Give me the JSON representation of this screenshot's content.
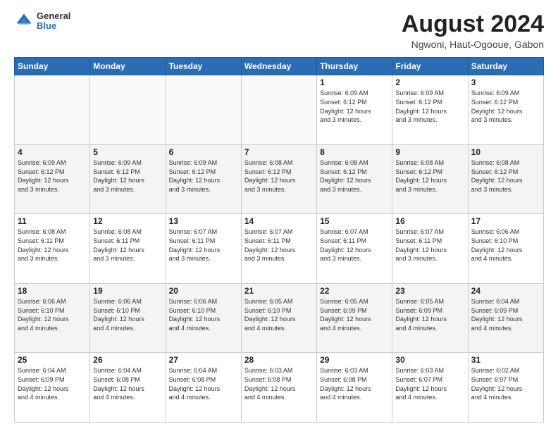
{
  "header": {
    "logo": {
      "general": "General",
      "blue": "Blue"
    },
    "title": "August 2024",
    "subtitle": "Ngwoni, Haut-Ogooue, Gabon"
  },
  "calendar": {
    "days_of_week": [
      "Sunday",
      "Monday",
      "Tuesday",
      "Wednesday",
      "Thursday",
      "Friday",
      "Saturday"
    ],
    "weeks": [
      {
        "row_bg": "white",
        "days": [
          {
            "num": "",
            "info": ""
          },
          {
            "num": "",
            "info": ""
          },
          {
            "num": "",
            "info": ""
          },
          {
            "num": "",
            "info": ""
          },
          {
            "num": "1",
            "info": "Sunrise: 6:09 AM\nSunset: 6:12 PM\nDaylight: 12 hours\nand 3 minutes."
          },
          {
            "num": "2",
            "info": "Sunrise: 6:09 AM\nSunset: 6:12 PM\nDaylight: 12 hours\nand 3 minutes."
          },
          {
            "num": "3",
            "info": "Sunrise: 6:09 AM\nSunset: 6:12 PM\nDaylight: 12 hours\nand 3 minutes."
          }
        ]
      },
      {
        "row_bg": "gray",
        "days": [
          {
            "num": "4",
            "info": "Sunrise: 6:09 AM\nSunset: 6:12 PM\nDaylight: 12 hours\nand 3 minutes."
          },
          {
            "num": "5",
            "info": "Sunrise: 6:09 AM\nSunset: 6:12 PM\nDaylight: 12 hours\nand 3 minutes."
          },
          {
            "num": "6",
            "info": "Sunrise: 6:09 AM\nSunset: 6:12 PM\nDaylight: 12 hours\nand 3 minutes."
          },
          {
            "num": "7",
            "info": "Sunrise: 6:08 AM\nSunset: 6:12 PM\nDaylight: 12 hours\nand 3 minutes."
          },
          {
            "num": "8",
            "info": "Sunrise: 6:08 AM\nSunset: 6:12 PM\nDaylight: 12 hours\nand 3 minutes."
          },
          {
            "num": "9",
            "info": "Sunrise: 6:08 AM\nSunset: 6:12 PM\nDaylight: 12 hours\nand 3 minutes."
          },
          {
            "num": "10",
            "info": "Sunrise: 6:08 AM\nSunset: 6:12 PM\nDaylight: 12 hours\nand 3 minutes."
          }
        ]
      },
      {
        "row_bg": "white",
        "days": [
          {
            "num": "11",
            "info": "Sunrise: 6:08 AM\nSunset: 6:11 PM\nDaylight: 12 hours\nand 3 minutes."
          },
          {
            "num": "12",
            "info": "Sunrise: 6:08 AM\nSunset: 6:11 PM\nDaylight: 12 hours\nand 3 minutes."
          },
          {
            "num": "13",
            "info": "Sunrise: 6:07 AM\nSunset: 6:11 PM\nDaylight: 12 hours\nand 3 minutes."
          },
          {
            "num": "14",
            "info": "Sunrise: 6:07 AM\nSunset: 6:11 PM\nDaylight: 12 hours\nand 3 minutes."
          },
          {
            "num": "15",
            "info": "Sunrise: 6:07 AM\nSunset: 6:11 PM\nDaylight: 12 hours\nand 3 minutes."
          },
          {
            "num": "16",
            "info": "Sunrise: 6:07 AM\nSunset: 6:11 PM\nDaylight: 12 hours\nand 3 minutes."
          },
          {
            "num": "17",
            "info": "Sunrise: 6:06 AM\nSunset: 6:10 PM\nDaylight: 12 hours\nand 4 minutes."
          }
        ]
      },
      {
        "row_bg": "gray",
        "days": [
          {
            "num": "18",
            "info": "Sunrise: 6:06 AM\nSunset: 6:10 PM\nDaylight: 12 hours\nand 4 minutes."
          },
          {
            "num": "19",
            "info": "Sunrise: 6:06 AM\nSunset: 6:10 PM\nDaylight: 12 hours\nand 4 minutes."
          },
          {
            "num": "20",
            "info": "Sunrise: 6:06 AM\nSunset: 6:10 PM\nDaylight: 12 hours\nand 4 minutes."
          },
          {
            "num": "21",
            "info": "Sunrise: 6:05 AM\nSunset: 6:10 PM\nDaylight: 12 hours\nand 4 minutes."
          },
          {
            "num": "22",
            "info": "Sunrise: 6:05 AM\nSunset: 6:09 PM\nDaylight: 12 hours\nand 4 minutes."
          },
          {
            "num": "23",
            "info": "Sunrise: 6:05 AM\nSunset: 6:09 PM\nDaylight: 12 hours\nand 4 minutes."
          },
          {
            "num": "24",
            "info": "Sunrise: 6:04 AM\nSunset: 6:09 PM\nDaylight: 12 hours\nand 4 minutes."
          }
        ]
      },
      {
        "row_bg": "white",
        "days": [
          {
            "num": "25",
            "info": "Sunrise: 6:04 AM\nSunset: 6:09 PM\nDaylight: 12 hours\nand 4 minutes."
          },
          {
            "num": "26",
            "info": "Sunrise: 6:04 AM\nSunset: 6:08 PM\nDaylight: 12 hours\nand 4 minutes."
          },
          {
            "num": "27",
            "info": "Sunrise: 6:04 AM\nSunset: 6:08 PM\nDaylight: 12 hours\nand 4 minutes."
          },
          {
            "num": "28",
            "info": "Sunrise: 6:03 AM\nSunset: 6:08 PM\nDaylight: 12 hours\nand 4 minutes."
          },
          {
            "num": "29",
            "info": "Sunrise: 6:03 AM\nSunset: 6:08 PM\nDaylight: 12 hours\nand 4 minutes."
          },
          {
            "num": "30",
            "info": "Sunrise: 6:03 AM\nSunset: 6:07 PM\nDaylight: 12 hours\nand 4 minutes."
          },
          {
            "num": "31",
            "info": "Sunrise: 6:02 AM\nSunset: 6:07 PM\nDaylight: 12 hours\nand 4 minutes."
          }
        ]
      }
    ]
  }
}
